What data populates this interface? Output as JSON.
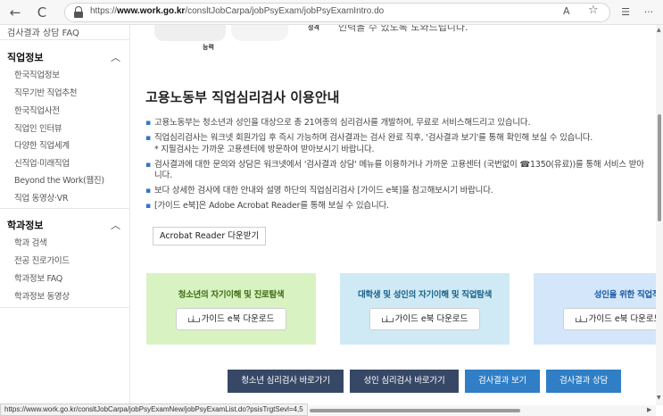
{
  "browser": {
    "url_prefix": "https://",
    "url_host": "www.work.go.kr",
    "url_path": "/consltJobCarpa/jobPsyExam/jobPsyExamIntro.do",
    "read_aloud": "A",
    "back_glyph": "←",
    "refresh_glyph": "C",
    "star_glyph": "☆",
    "menu_glyph": "···"
  },
  "sidebar": {
    "top_item": "검사결과 상담 FAQ",
    "sections": [
      {
        "heading": "직업정보",
        "items": [
          "한국직업정보",
          "직무기반 직업추천",
          "한국직업사전",
          "직업인 인터뷰",
          "다양한 직업세계",
          "신직업·미래직업",
          "Beyond the Work(웹진)",
          "직업 동영상·VR"
        ]
      },
      {
        "heading": "학과정보",
        "items": [
          "학과 검색",
          "전공 진로가이드",
          "학과정보 FAQ",
          "학과정보 동영상"
        ]
      }
    ]
  },
  "hero": {
    "caption_left": "능력",
    "caption_right": "성격",
    "text": "인력을 수 있도록 도와드립니다."
  },
  "intro": {
    "title": "고용노동부 직업심리검사 이용안내",
    "notes": [
      "고용노동부는 청소년과 성인을 대상으로 총 21여종의 심리검사를 개발하여, 무료로 서비스해드리고 있습니다.",
      "직업심리검사는 워크넷 회원가입 후 즉시 가능하며 검사결과는 검사 완료 직후, '검사결과 보기'를 통해 확인해 보실 수 있습니다.",
      "검사결과에 대한 문의와 상담은 워크넷에서 '검사결과 상담' 메뉴를 이용하거나 가까운 고용센터 (국번없이 ☎1350(유료))를 통해 서비스 받아",
      "보다 상세한 검사에 대한 안내와 설명 하단의 직업심리검사 [가이드 e북]을 참고해보시기 바랍니다.",
      "[가이드 e북]은 Adobe Acrobat Reader를 통해 보실 수 있습니다."
    ],
    "sub_note": "* 지필검사는 가까운 고용센터에 방문하여 받아보시기 바랍니다.",
    "note_continuation": "니다.",
    "acrobat_button": "Acrobat Reader 다운받기"
  },
  "guides": [
    {
      "title": "청소년의 자기이해 및 진로탐색",
      "button": "가이드 e북 다운로드",
      "bg": "#d9f2c2",
      "title_color": "#3d6b12"
    },
    {
      "title": "대학생 및 성인의 자기이해 및 직업탐색",
      "button": "가이드 e북 다운로드",
      "bg": "#cfeaf4",
      "title_color": "#1a5f8a"
    },
    {
      "title": "성인을 위한 직업적응검",
      "button": "가이드 e북 다운로드",
      "bg": "#d3e6fa",
      "title_color": "#1c5aa6"
    }
  ],
  "nav_buttons": [
    {
      "label": "청소년 심리검사 바로가기",
      "bg": "#374867"
    },
    {
      "label": "성인 심리검사 바로가기",
      "bg": "#374867"
    },
    {
      "label": "검사결과 보기",
      "bg": "#2f7ec6"
    },
    {
      "label": "검사결과 상담",
      "bg": "#2f7ec6"
    }
  ],
  "status_url": "https://www.work.go.kr/consltJobCarpa/jobPsyExamNew/jobPsyExamList.do?psisTrgtSevl=4,5"
}
